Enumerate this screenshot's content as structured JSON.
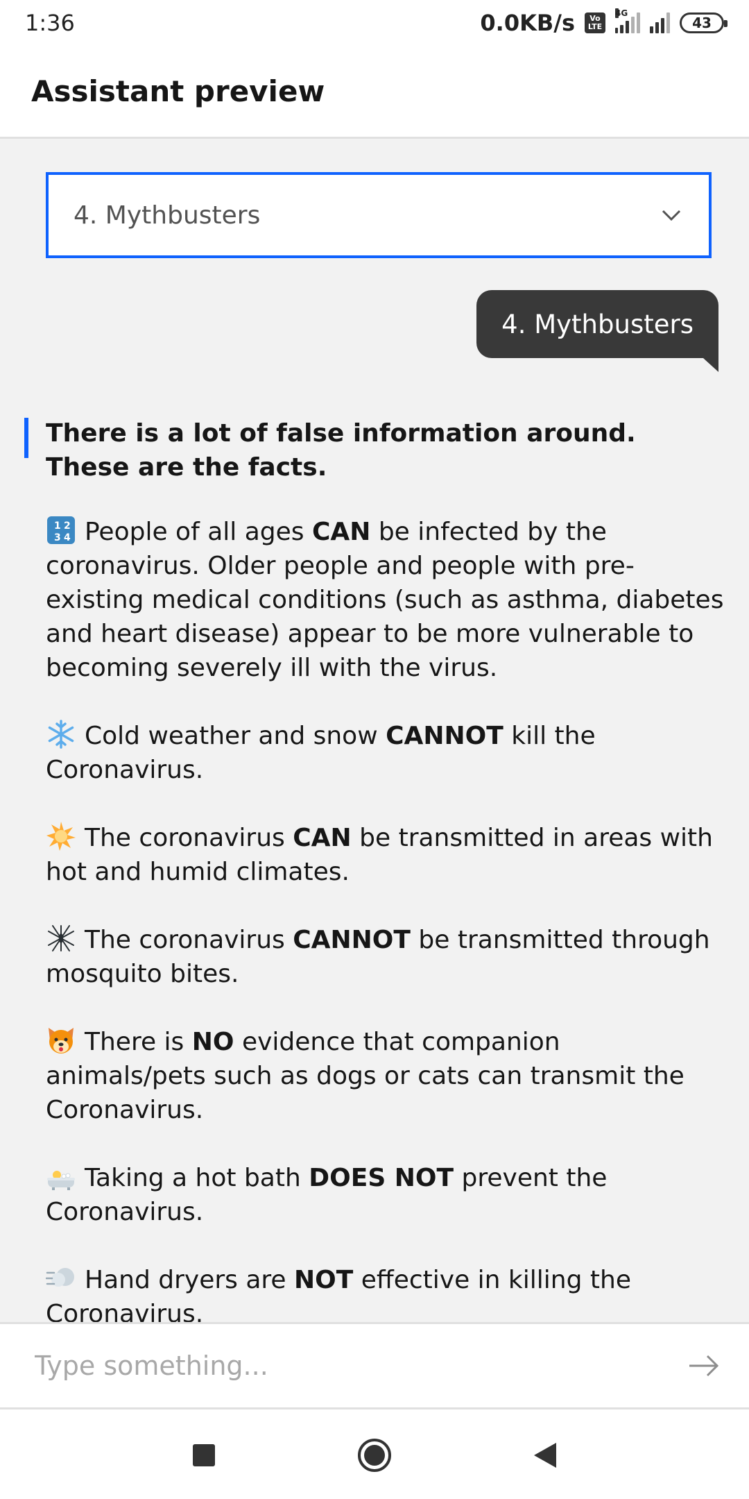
{
  "status_bar": {
    "time": "1:36",
    "net_speed": "0.0KB/s",
    "volte_top": "Vo",
    "volte_bottom": "LTE",
    "network_type": "4G",
    "battery": "43"
  },
  "app_bar": {
    "title": "Assistant preview"
  },
  "dropdown": {
    "selected": "4. Mythbusters"
  },
  "user_message": "4. Mythbusters",
  "bot_message": {
    "heading": "There is a lot of false information around. These are the facts.",
    "items": [
      {
        "icon": "numbers-icon",
        "pre": "People of all ages ",
        "bold": "CAN",
        "post": " be infected by the coronavirus. Older people and people with pre-existing medical conditions (such as asthma, diabetes and heart disease) appear to be more vulnerable to becoming severely ill with the virus."
      },
      {
        "icon": "snowflake-icon",
        "pre": "Cold weather and snow ",
        "bold": "CANNOT",
        "post": " kill the Coronavirus."
      },
      {
        "icon": "sun-icon",
        "pre": "The coronavirus ",
        "bold": "CAN",
        "post": " be transmitted in areas with hot and humid climates."
      },
      {
        "icon": "mosquito-icon",
        "pre": "The coronavirus ",
        "bold": "CANNOT",
        "post": " be transmitted through mosquito bites."
      },
      {
        "icon": "dog-face-icon",
        "pre": "There is ",
        "bold": "NO",
        "post": " evidence that companion animals/pets such as dogs or cats can transmit the Coronavirus."
      },
      {
        "icon": "bath-icon",
        "pre": "Taking a hot bath ",
        "bold": "DOES NOT",
        "post": " prevent the Coronavirus."
      },
      {
        "icon": "wind-icon",
        "pre": "Hand dryers are ",
        "bold": "NOT",
        "post": " effective in killing the Coronavirus."
      }
    ]
  },
  "input": {
    "placeholder": "Type something..."
  },
  "colors": {
    "accent": "#0f62fe",
    "user_bubble": "#393939",
    "chat_bg": "#f2f2f2"
  }
}
